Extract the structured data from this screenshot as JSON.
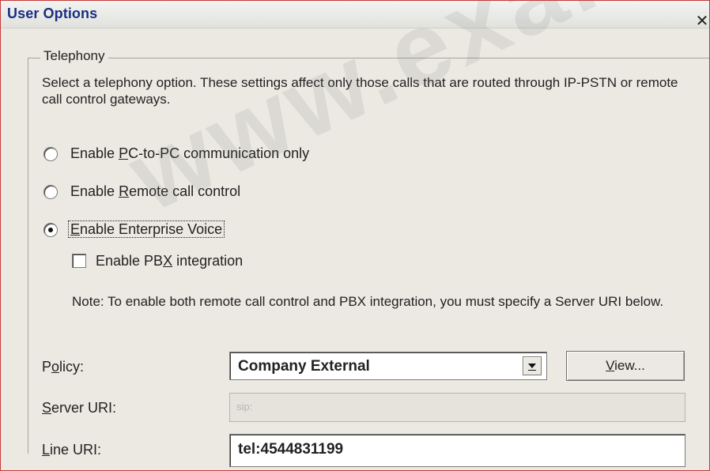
{
  "window": {
    "title": "User Options",
    "close_symbol": "✕"
  },
  "telephony": {
    "group_label": "Telephony",
    "description": "Select a telephony option. These settings affect only those calls that are routed through IP-PSTN or remote call control gateways.",
    "options": [
      {
        "pre": "Enable ",
        "mnemonic": "P",
        "post": "C-to-PC communication only",
        "selected": false
      },
      {
        "pre": "Enable ",
        "mnemonic": "R",
        "post": "emote call control",
        "selected": false
      },
      {
        "pre": "",
        "mnemonic": "E",
        "post": "nable Enterprise Voice",
        "selected": true
      }
    ],
    "pbx": {
      "pre": "Enable PB",
      "mnemonic": "X",
      "post": " integration",
      "checked": false
    },
    "note": "Note: To enable both remote call control and PBX integration, you must specify a Server URI below."
  },
  "policy": {
    "label_pre": "P",
    "label_mnemonic": "o",
    "label_post": "licy:",
    "value": "Company External",
    "view_button": {
      "mnemonic": "V",
      "post": "iew..."
    }
  },
  "server_uri": {
    "label_mnemonic": "S",
    "label_post": "erver URI:",
    "value": "sip:"
  },
  "line_uri": {
    "label_mnemonic": "L",
    "label_post": "ine URI:",
    "value": "tel:4544831199"
  },
  "watermark": {
    "text": "www.examk"
  }
}
